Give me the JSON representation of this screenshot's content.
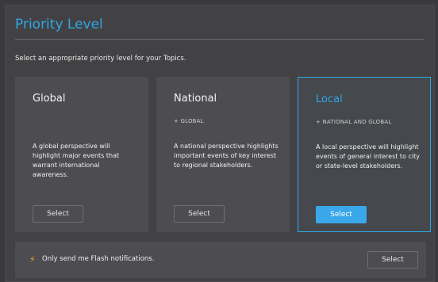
{
  "header": {
    "title": "Priority Level",
    "subtitle": "Select an appropriate priority level for your Topics."
  },
  "cards": [
    {
      "name": "Global",
      "scope": "",
      "description": "A global perspective will highlight major events that warrant international awareness.",
      "button_label": "Select",
      "selected": false
    },
    {
      "name": "National",
      "scope": "+ GLOBAL",
      "description": "A national perspective highlights important events of key interest to regional stakeholders.",
      "button_label": "Select",
      "selected": false
    },
    {
      "name": "Local",
      "scope": "+ NATIONAL AND GLOBAL",
      "description": "A local perspective will highlight events of general interest to city or state-level stakeholders.",
      "button_label": "Select",
      "selected": true
    }
  ],
  "flash": {
    "icon": "lightning-bolt-icon",
    "text": "Only send me Flash notifications.",
    "button_label": "Select"
  },
  "colors": {
    "accent": "#2fa7e6",
    "flash_icon": "#f2a12e"
  }
}
